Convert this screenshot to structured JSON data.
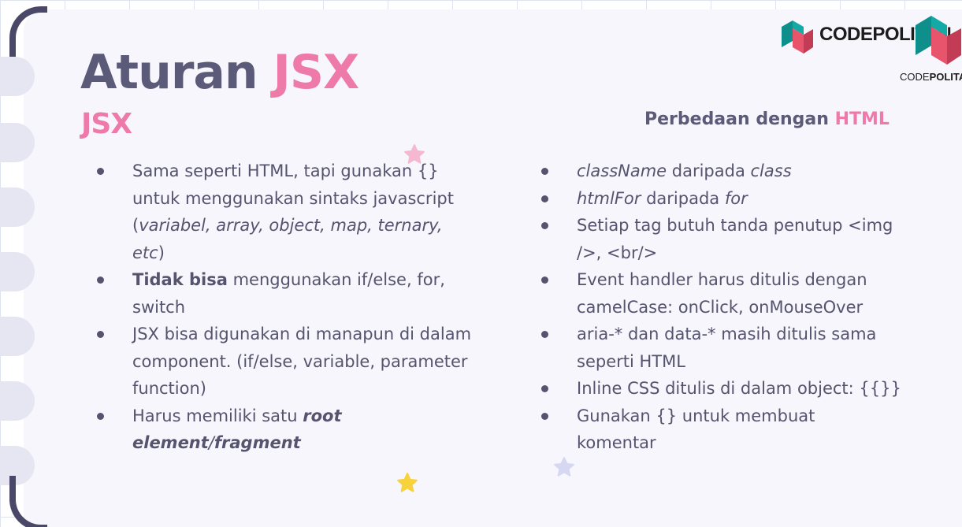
{
  "slide": {
    "title_main": "Aturan",
    "title_accent": "JSX",
    "left_heading": "JSX",
    "right_heading_main": "Perbedaan dengan",
    "right_heading_accent": "HTML"
  },
  "logo": {
    "text": "CODEPOLITAN",
    "small_text_prefix": "CODE",
    "small_text_suffix": "POLITA"
  },
  "left_list": [
    {
      "a": "Sama seperti HTML, tapi gunakan {} untuk menggunakan sintaks javascript (",
      "b": "variabel, array, object, map, ternary, etc",
      "c": ")"
    },
    {
      "a": "Tidak bisa",
      "b": " menggunakan if/else, for, switch"
    },
    {
      "text": "JSX bisa digunakan di manapun di dalam component. (if/else, variable, parameter function)"
    },
    {
      "a": "Harus memiliki satu ",
      "b": "root element",
      "c": "/",
      "d": "fragment"
    }
  ],
  "right_list": [
    {
      "a": "className",
      "b": " daripada ",
      "c": "class"
    },
    {
      "a": "htmlFor",
      "b": " daripada ",
      "c": "for"
    },
    {
      "text": "Setiap tag butuh tanda penutup <img />, <br/>"
    },
    {
      "text": "Event handler harus ditulis dengan camelCase: onClick, onMouseOver"
    },
    {
      "text": "aria-* dan data-* masih ditulis sama seperti HTML"
    },
    {
      "text": "Inline CSS ditulis di dalam object: {{}}"
    },
    {
      "text": "Gunakan {} untuk membuat komentar"
    }
  ],
  "colors": {
    "primary_text": "#55536e",
    "heading": "#5b5a78",
    "accent_pink": "#ee7aaa",
    "star_yellow": "#f7d23c",
    "star_lavender": "#d6d8f2",
    "logo_teal": "#0f8f8b",
    "logo_pink": "#e8546c"
  }
}
